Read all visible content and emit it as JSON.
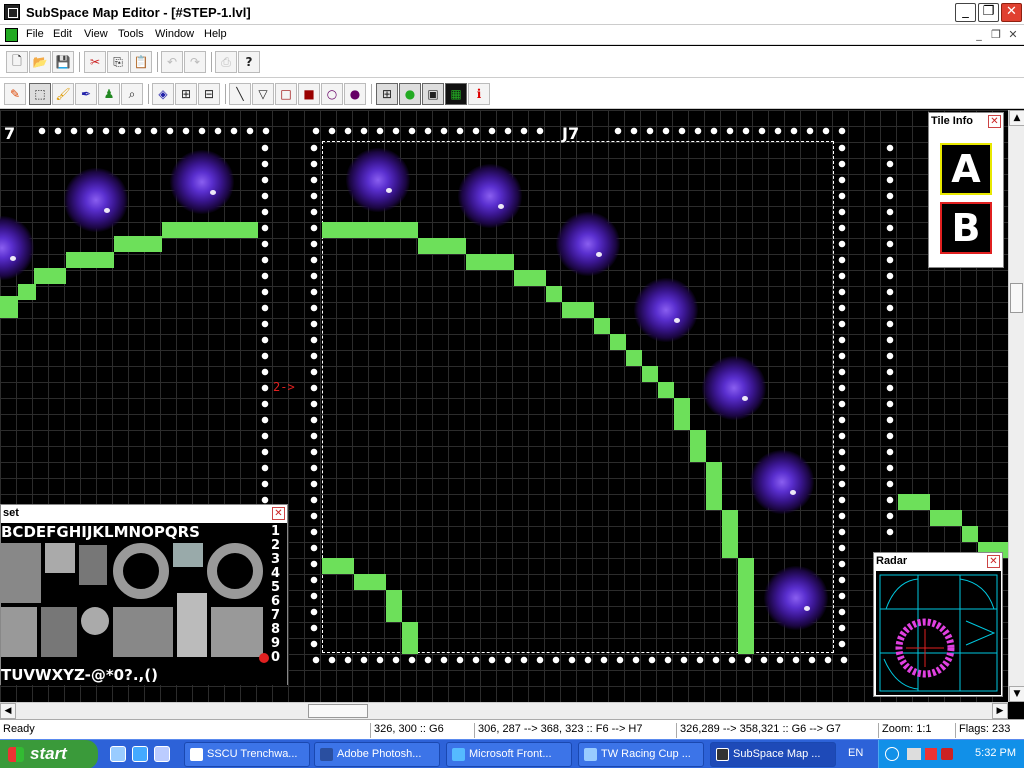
{
  "window": {
    "title": "SubSpace Map Editor - [#STEP-1.lvl]",
    "minimize": "_",
    "maximize": "❐",
    "close": "✕"
  },
  "menu": {
    "items": [
      "File",
      "Edit",
      "View",
      "Tools",
      "Window",
      "Help"
    ],
    "doc_minimize": "_",
    "doc_restore": "❐",
    "doc_close": "✕"
  },
  "toolbar1": {
    "buttons": [
      {
        "icon": "new-file-icon",
        "glyph": "🗋"
      },
      {
        "icon": "open-folder-icon",
        "glyph": "📂"
      },
      {
        "icon": "save-icon",
        "glyph": "💾"
      },
      {
        "icon": "cut-icon",
        "glyph": "✂"
      },
      {
        "icon": "copy-icon",
        "glyph": "⎘"
      },
      {
        "icon": "paste-icon",
        "glyph": "📋"
      },
      {
        "icon": "undo-icon",
        "glyph": "↶"
      },
      {
        "icon": "redo-icon",
        "glyph": "↷"
      },
      {
        "icon": "print-icon",
        "glyph": "⎙"
      },
      {
        "icon": "help-icon",
        "glyph": "?"
      }
    ]
  },
  "toolbar2": {
    "buttons": [
      {
        "icon": "pencil-icon",
        "glyph": "✎"
      },
      {
        "icon": "select-icon",
        "glyph": "⬚"
      },
      {
        "icon": "brush-icon",
        "glyph": "🖌"
      },
      {
        "icon": "dropper-icon",
        "glyph": "✒"
      },
      {
        "icon": "stamp-icon",
        "glyph": "♟"
      },
      {
        "icon": "zoom-icon",
        "glyph": "⌕"
      },
      {
        "icon": "fill-icon",
        "glyph": "◈"
      },
      {
        "icon": "replace-icon",
        "glyph": "⊞"
      },
      {
        "icon": "mirror-icon",
        "glyph": "⊟"
      },
      {
        "icon": "line-icon",
        "glyph": "╲"
      },
      {
        "icon": "triangle-icon",
        "glyph": "▽"
      },
      {
        "icon": "rect-icon",
        "glyph": "□"
      },
      {
        "icon": "filled-rect-icon",
        "glyph": "■"
      },
      {
        "icon": "ellipse-icon",
        "glyph": "○"
      },
      {
        "icon": "filled-ellipse-icon",
        "glyph": "●"
      },
      {
        "icon": "grid-icon",
        "glyph": "⊞"
      },
      {
        "icon": "radar-toggle-icon",
        "glyph": "●"
      },
      {
        "icon": "tiles-toggle-icon",
        "glyph": "▣"
      },
      {
        "icon": "regions-icon",
        "glyph": "▦"
      },
      {
        "icon": "info-icon",
        "glyph": "i"
      }
    ]
  },
  "map": {
    "label_left": "7",
    "label_center": "J7",
    "marker": "2->"
  },
  "tile_info": {
    "title": "Tile Info",
    "close": "✕",
    "tile_a": "A",
    "tile_b": "B"
  },
  "tileset": {
    "title": "set",
    "close": "✕",
    "row_top": "BCDEFGHIJKLMNOPQRS",
    "row_bottom": "TUVWXYZ-@*0?.,()",
    "side_digits": "1234567890"
  },
  "radar": {
    "title": "Radar",
    "close": "✕"
  },
  "status": {
    "ready": "Ready",
    "cursor": "326,  300 :: G6",
    "selection": "306, 287 --> 368, 323 :: F6 --> H7",
    "region": "326,289 --> 358,321 :: G6 --> G7",
    "zoom": "Zoom: 1:1",
    "flags": "Flags: 233"
  },
  "taskbar": {
    "start": "start",
    "tasks": [
      {
        "label": "SSCU Trenchwa...",
        "active": false
      },
      {
        "label": "Adobe Photosh...",
        "active": false
      },
      {
        "label": "Microsoft Front...",
        "active": false
      },
      {
        "label": "TW Racing Cup ...",
        "active": false
      },
      {
        "label": "SubSpace Map ...",
        "active": true
      }
    ],
    "language": "EN",
    "clock": "5:32 PM"
  },
  "colors": {
    "accent_green": "#6de05a",
    "wormhole_purple": "#5a2fcf",
    "marker_red": "#e02020",
    "tile_a_border": "#e8e800",
    "tile_b_border": "#e02020",
    "radar_cyan": "#00c8e0",
    "radar_magenta": "#e040e0"
  }
}
